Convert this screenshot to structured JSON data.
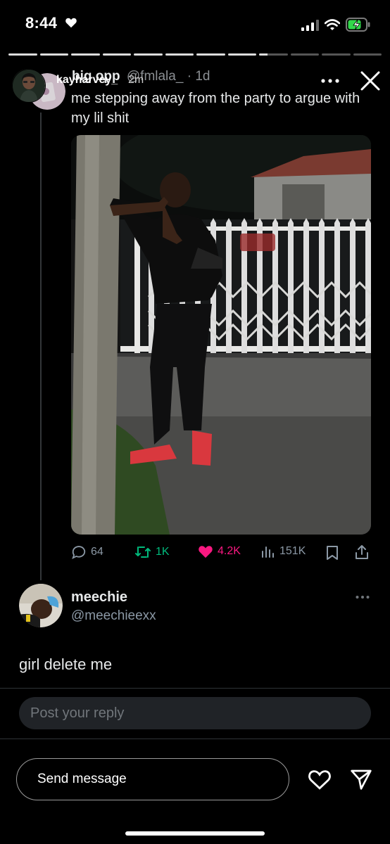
{
  "status_bar": {
    "time": "8:44"
  },
  "story": {
    "username": "kayharvey_",
    "time_ago": "2m",
    "segments_total": 12,
    "segments_filled": 8,
    "close_icon": "close-icon",
    "more_icon": "more-icon"
  },
  "tweet": {
    "display_name": "big opp",
    "handle": "@fmlala_",
    "time": "1d",
    "text": "me stepping away from the party to argue with my lil shit",
    "stats": {
      "replies": "64",
      "reposts": "1K",
      "likes": "4.2K",
      "views": "151K"
    }
  },
  "reply": {
    "display_name": "meechie",
    "handle": "@meechieexx",
    "text": "girl delete me"
  },
  "reply_composer": {
    "placeholder": "Post your reply"
  },
  "message_bar": {
    "placeholder": "Send message"
  },
  "colors": {
    "like": "#f91880",
    "repost": "#00ba7c",
    "muted": "#8b98a5"
  }
}
